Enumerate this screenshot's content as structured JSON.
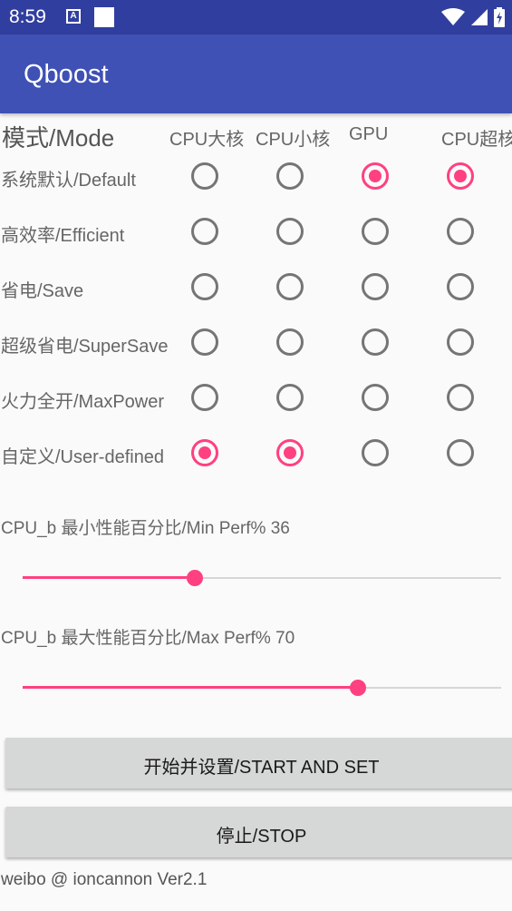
{
  "status_bar": {
    "time": "8:59",
    "notification_icon_letter": "A",
    "icons": [
      "notification-a-icon",
      "notification-square-icon",
      "wifi-icon",
      "cell-signal-icon",
      "battery-icon"
    ]
  },
  "app_bar": {
    "title": "Qboost"
  },
  "mode_table": {
    "header": "模式/Mode",
    "columns": [
      "CPU大核",
      "CPU小核",
      "GPU",
      "CPU超核"
    ],
    "rows": [
      {
        "label": "系统默认/Default",
        "checked": [
          false,
          false,
          true,
          true
        ]
      },
      {
        "label": "高效率/Efficient",
        "checked": [
          false,
          false,
          false,
          false
        ]
      },
      {
        "label": "省电/Save",
        "checked": [
          false,
          false,
          false,
          false
        ]
      },
      {
        "label": "超级省电/SuperSave",
        "checked": [
          false,
          false,
          false,
          false
        ]
      },
      {
        "label": "火力全开/MaxPower",
        "checked": [
          false,
          false,
          false,
          false
        ]
      },
      {
        "label": "自定义/User-defined",
        "checked": [
          true,
          true,
          false,
          false
        ]
      }
    ]
  },
  "sliders": {
    "min_perf": {
      "label": "CPU_b 最小性能百分比/Min Perf% 36",
      "value": 36
    },
    "max_perf": {
      "label": "CPU_b 最大性能百分比/Max Perf% 70",
      "value": 70
    }
  },
  "buttons": {
    "start": "开始并设置/START AND SET",
    "stop": "停止/STOP"
  },
  "footer": "weibo @ ioncannon Ver2.1",
  "colors": {
    "status_bar": "#303f9f",
    "app_bar": "#3f51b5",
    "accent": "#ff4081",
    "radio_unchecked": "#757575",
    "button_bg": "#d6d7d7"
  }
}
